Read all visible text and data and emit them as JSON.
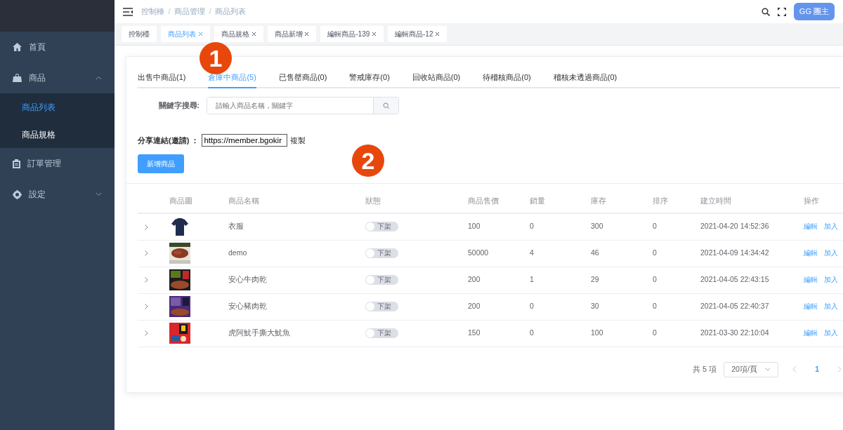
{
  "sidebar": {
    "items": [
      {
        "label": "首頁",
        "selected": false
      },
      {
        "label": "商品",
        "selected": false,
        "expanded": true,
        "children": [
          {
            "label": "商品列表",
            "selected": true
          },
          {
            "label": "商品規格",
            "selected": false
          }
        ]
      },
      {
        "label": "訂單管理",
        "selected": false
      },
      {
        "label": "設定",
        "selected": false,
        "expanded": false
      }
    ]
  },
  "breadcrumb": [
    {
      "label": "控制檯",
      "kind": "link"
    },
    {
      "label": "/",
      "kind": "separator"
    },
    {
      "label": "商品管理",
      "kind": "link"
    },
    {
      "label": "/",
      "kind": "separator"
    },
    {
      "label": "商品列表",
      "kind": "link"
    }
  ],
  "header": {
    "user_button": "GG 團主"
  },
  "page_tabs": [
    {
      "label": "控制檯",
      "selected": false,
      "closable": false
    },
    {
      "label": "商品列表",
      "selected": true,
      "closable": true
    },
    {
      "label": "商品規格",
      "selected": false,
      "closable": true
    },
    {
      "label": "商品新增",
      "selected": false,
      "closable": true
    },
    {
      "label": "編輯商品-139",
      "selected": false,
      "closable": true
    },
    {
      "label": "編輯商品-12",
      "selected": false,
      "closable": true
    }
  ],
  "markers": [
    "1",
    "2"
  ],
  "status_tabs": [
    {
      "label": "出售中商品(1)",
      "selected": false
    },
    {
      "label": "倉庫中商品(5)",
      "selected": true
    },
    {
      "label": "已售罄商品(0)",
      "selected": false
    },
    {
      "label": "警戒庫存(0)",
      "selected": false
    },
    {
      "label": "回收站商品(0)",
      "selected": false
    },
    {
      "label": "待稽核商品(0)",
      "selected": false
    },
    {
      "label": "稽核未透過商品(0)",
      "selected": false
    }
  ],
  "search": {
    "label": "關鍵字搜尋:",
    "placeholder": "請輸入商品名稱，關鍵字"
  },
  "share": {
    "label": "分享連結(邀請) ：",
    "value": "https://member.bgokir",
    "copy": "複製"
  },
  "add_button": "新增商品",
  "table": {
    "columns": [
      "商品圖",
      "商品名稱",
      "狀態",
      "商品售價",
      "銷量",
      "庫存",
      "排序",
      "建立時間",
      "操作"
    ],
    "rows": [
      {
        "name": "衣服",
        "status": {
          "label": "下架",
          "on": false
        },
        "price": "100",
        "sales": "0",
        "stock": "300",
        "sort": "0",
        "created": "2021-04-20 14:52:36",
        "actions": [
          "編輯",
          "加入"
        ]
      },
      {
        "name": "demo",
        "status": {
          "label": "下架",
          "on": false
        },
        "price": "50000",
        "sales": "4",
        "stock": "46",
        "sort": "0",
        "created": "2021-04-09 14:34:42",
        "actions": [
          "編輯",
          "加入"
        ]
      },
      {
        "name": "安心牛肉乾",
        "status": {
          "label": "下架",
          "on": false
        },
        "price": "200",
        "sales": "1",
        "stock": "29",
        "sort": "0",
        "created": "2021-04-05 22:43:15",
        "actions": [
          "編輯",
          "加入"
        ]
      },
      {
        "name": "安心豬肉乾",
        "status": {
          "label": "下架",
          "on": false
        },
        "price": "200",
        "sales": "0",
        "stock": "30",
        "sort": "0",
        "created": "2021-04-05 22:40:37",
        "actions": [
          "編輯",
          "加入"
        ]
      },
      {
        "name": "虎阿魷手撕大魷魚",
        "status": {
          "label": "下架",
          "on": false
        },
        "price": "150",
        "sales": "0",
        "stock": "100",
        "sort": "0",
        "created": "2021-03-30 22:10:04",
        "actions": [
          "編輯",
          "加入"
        ]
      }
    ]
  },
  "pagination": {
    "total": "共 5 項",
    "page_size": "20項/頁",
    "pages": [
      {
        "label": "1",
        "selected": true
      }
    ]
  }
}
